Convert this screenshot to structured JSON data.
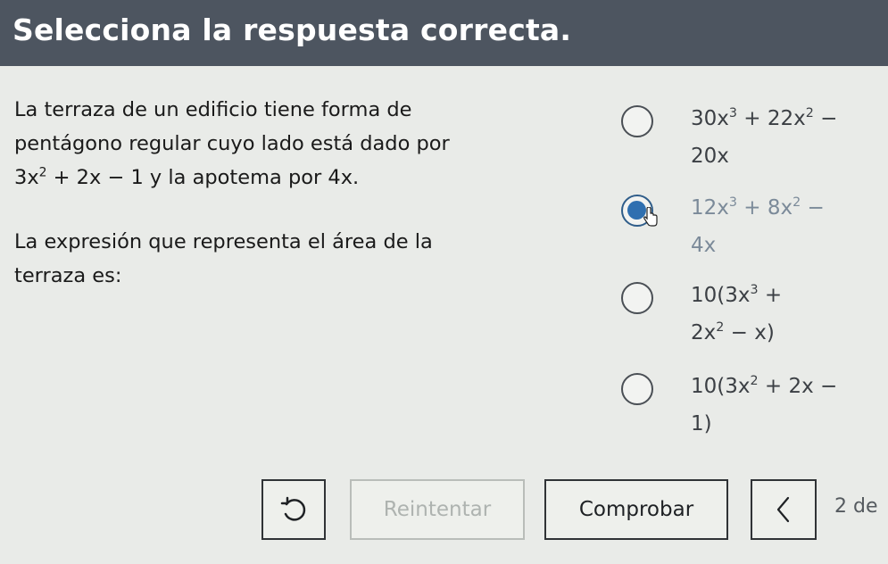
{
  "header": {
    "title": "Selecciona la respuesta correcta."
  },
  "question": {
    "line1": "La terraza de un edificio tiene forma de",
    "line2": "pentágono regular cuyo lado está dado por",
    "line3_a": "3x",
    "line3_exp": "2",
    "line3_b": " + 2x − 1 y la apotema por 4x.",
    "line4": "La expresión que representa el área de la",
    "line5": "terraza es:"
  },
  "options": [
    {
      "selected": false,
      "l1_a": "30x",
      "l1_e1": "3",
      "l1_b": " + 22x",
      "l1_e2": "2",
      "l1_c": " −",
      "l2_a": "20x",
      "l2_e": "",
      "l2_b": ""
    },
    {
      "selected": true,
      "l1_a": "12x",
      "l1_e1": "3",
      "l1_b": " + 8x",
      "l1_e2": "2",
      "l1_c": " −",
      "l2_a": "4x",
      "l2_e": "",
      "l2_b": ""
    },
    {
      "selected": false,
      "l1_a": "10(3x",
      "l1_e1": "3",
      "l1_b": " +",
      "l1_e2": "",
      "l1_c": "",
      "l2_a": "2x",
      "l2_e": "2",
      "l2_b": " − x)"
    },
    {
      "selected": false,
      "l1_a": "10(3x",
      "l1_e1": "2",
      "l1_b": " + 2x −",
      "l1_e2": "",
      "l1_c": "",
      "l2_a": "1)",
      "l2_e": "",
      "l2_b": ""
    }
  ],
  "footer": {
    "reset_icon": "undo-icon",
    "retry_label": "Reintentar",
    "check_label": "Comprobar",
    "prev_icon": "chevron-left-icon",
    "page_indicator": "2 de"
  },
  "colors": {
    "header_bg": "#4d5560",
    "page_bg": "#e9ebe8",
    "radio_selected": "#2f6fb0"
  }
}
